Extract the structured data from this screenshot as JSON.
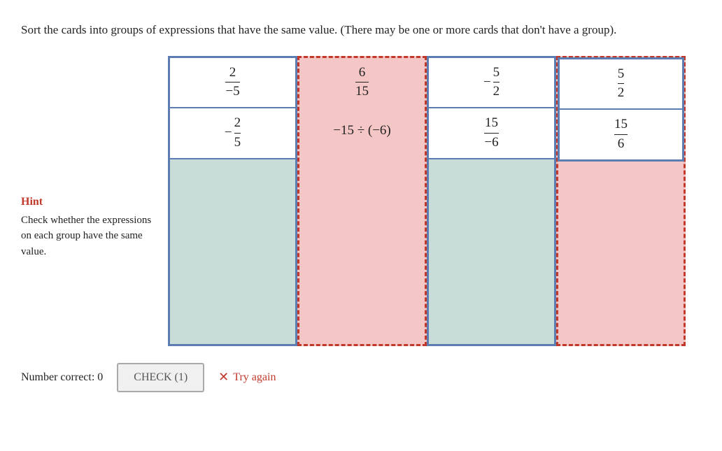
{
  "instructions": {
    "text": "Sort the cards into groups of expressions that have the same value. (There may be one or more cards that don't have a group)."
  },
  "hint": {
    "title": "Hint",
    "text": "Check whether the expressions on each group have the same value."
  },
  "columns": [
    {
      "id": "col1",
      "type": "blue-solid",
      "cards": [
        {
          "type": "fraction",
          "neg": false,
          "numerator": "2",
          "denominator": "−5"
        },
        {
          "type": "fraction",
          "neg": true,
          "numerator": "2",
          "denominator": "5"
        }
      ]
    },
    {
      "id": "col2",
      "type": "red-dashed",
      "cards": [
        {
          "type": "fraction",
          "neg": false,
          "numerator": "6",
          "denominator": "15"
        },
        {
          "type": "expression",
          "value": "−15 ÷ (−6)"
        }
      ]
    },
    {
      "id": "col3",
      "type": "blue-solid",
      "cards": [
        {
          "type": "fraction",
          "neg": true,
          "numerator": "5",
          "denominator": "2"
        },
        {
          "type": "fraction",
          "neg": false,
          "numerator": "15",
          "denominator": "−6"
        }
      ]
    },
    {
      "id": "col4",
      "type": "red-dashed-with-blue-cards",
      "cards": [
        {
          "type": "fraction",
          "neg": false,
          "numerator": "5",
          "denominator": "2"
        },
        {
          "type": "fraction",
          "neg": false,
          "numerator": "15",
          "denominator": "6"
        }
      ]
    }
  ],
  "bottom": {
    "number_correct_label": "Number correct: 0",
    "check_button_label": "CHECK (1)",
    "try_again_label": "Try again"
  }
}
